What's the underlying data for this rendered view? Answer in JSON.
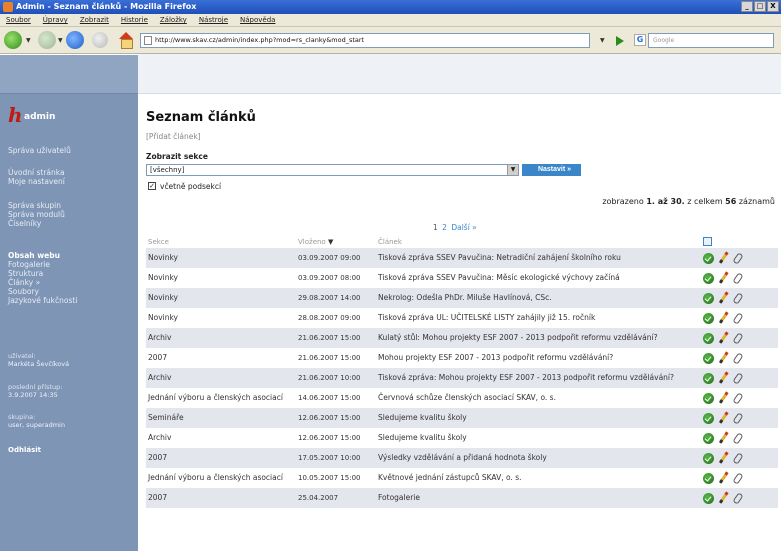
{
  "window": {
    "title": "Admin - Seznam článků - Mozilla Firefox",
    "controls": [
      "_",
      "□",
      "X"
    ]
  },
  "menubar": [
    "Soubor",
    "Úpravy",
    "Zobrazit",
    "Historie",
    "Záložky",
    "Nástroje",
    "Nápověda"
  ],
  "navbar": {
    "url": "http://www.skav.cz/admin/index.php?mod=rs_clanky&mod_start",
    "search_engine_letter": "G",
    "search_placeholder": "Google"
  },
  "sidebar": {
    "logo_letter": "h",
    "logo_text": "admin",
    "group1": [
      "Správa uživatelů"
    ],
    "group2": [
      "Úvodní stránka",
      "Moje nastavení"
    ],
    "group3": [
      "Správa skupin",
      "Správa modulů",
      "Číselníky"
    ],
    "group4_active": "Obsah webu",
    "group4": [
      "Fotogalerie",
      "Struktura",
      "Články »",
      "Soubory",
      "Jazykové fukčnosti"
    ],
    "user_label": "uživatel:",
    "user_name": "Markéta Ševčíková",
    "last_access_label": "poslední přístup:",
    "last_access": "3.9.2007 14:35",
    "group_label": "skupina:",
    "group_value": "user, superadmin",
    "logout": "Odhlásit"
  },
  "main": {
    "title": "Seznam článků",
    "add_link": "[Přidat článek]",
    "section_label": "Zobrazit sekce",
    "section_value": "[všechny]",
    "apply_button": "Nastavit »",
    "checkbox_checked": true,
    "checkbox_label": "včetně podsekcí",
    "count_prefix": "zobrazeno",
    "count_range": "1. až 30.",
    "count_middle": "z celkem",
    "count_total": "56",
    "count_suffix": "záznamů",
    "pager": {
      "pages": [
        "1",
        "2"
      ],
      "next": "Další »"
    },
    "columns": {
      "sekce": "Sekce",
      "date": "Vloženo",
      "title": "Článek"
    },
    "rows": [
      {
        "sekce": "Novinky",
        "date": "03.09.2007 09:00",
        "title": "Tisková zpráva SSEV Pavučina: Netradiční zahájení školního roku"
      },
      {
        "sekce": "Novinky",
        "date": "03.09.2007 08:00",
        "title": "Tisková zpráva SSEV Pavučina: Měsíc ekologické výchovy začíná"
      },
      {
        "sekce": "Novinky",
        "date": "29.08.2007 14:00",
        "title": "Nekrolog: Odešla PhDr. Miluše Havlínová, CSc."
      },
      {
        "sekce": "Novinky",
        "date": "28.08.2007 09:00",
        "title": "Tisková zpráva UL: UČITELSKÉ LISTY zahájily již 15. ročník"
      },
      {
        "sekce": "Archiv",
        "date": "21.06.2007 15:00",
        "title": "Kulatý stůl: Mohou projekty ESF 2007 - 2013 podpořit reformu vzdělávání?"
      },
      {
        "sekce": "2007",
        "date": "21.06.2007 15:00",
        "title": "Mohou projekty ESF 2007 - 2013 podpořit reformu vzdělávání?"
      },
      {
        "sekce": "Archiv",
        "date": "21.06.2007 10:00",
        "title": "Tisková zpráva: Mohou projekty ESF 2007 - 2013 podpořit reformu vzdělávání?"
      },
      {
        "sekce": "Jednání výboru a členských asociací",
        "date": "14.06.2007 15:00",
        "title": "Červnová schůze členských asociací SKAV, o. s."
      },
      {
        "sekce": "Semináře",
        "date": "12.06.2007 15:00",
        "title": "Sledujeme kvalitu školy"
      },
      {
        "sekce": "Archiv",
        "date": "12.06.2007 15:00",
        "title": "Sledujeme kvalitu školy"
      },
      {
        "sekce": "2007",
        "date": "17.05.2007 10:00",
        "title": "Výsledky vzdělávání a přidaná hodnota školy"
      },
      {
        "sekce": "Jednání výboru a členských asociací",
        "date": "10.05.2007 15:00",
        "title": "Květnové jednání zástupců SKAV, o. s."
      },
      {
        "sekce": "2007",
        "date": "25.04.2007",
        "title": "Fotogalerie"
      }
    ]
  }
}
